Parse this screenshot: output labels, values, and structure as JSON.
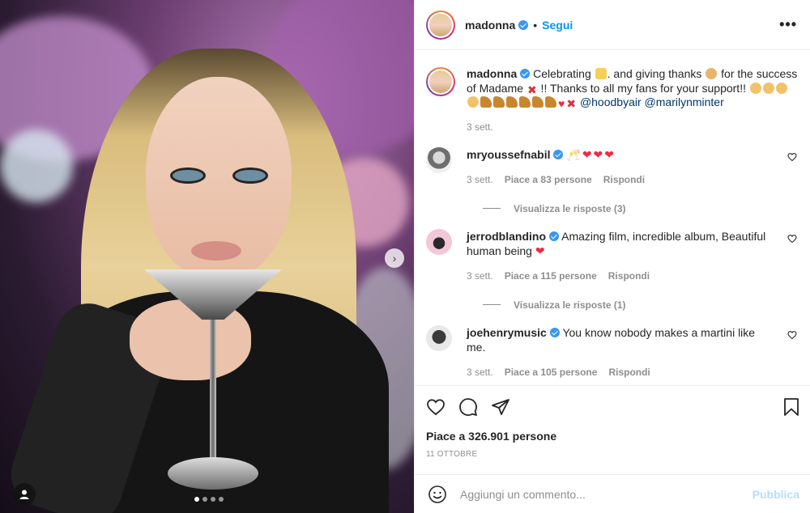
{
  "post": {
    "username": "madonna",
    "separator": "•",
    "follow_label": "Segui",
    "more_label": "•••",
    "carousel_dot_count": 4,
    "carousel_active_index": 0
  },
  "caption": {
    "username": "madonna",
    "text_parts": [
      {
        "kind": "text",
        "value": "Celebrating "
      },
      {
        "kind": "emoji",
        "name": "trophy-icon"
      },
      {
        "kind": "text",
        "value": ". and giving thanks "
      },
      {
        "kind": "emoji",
        "name": "pray-icon"
      },
      {
        "kind": "text",
        "value": " for the success of Madame "
      },
      {
        "kind": "emoji",
        "name": "x-icon"
      },
      {
        "kind": "text",
        "value": " !! Thanks to all my fans for your support!! "
      },
      {
        "kind": "emoji",
        "name": "clap-icon"
      },
      {
        "kind": "emoji",
        "name": "clap-icon"
      },
      {
        "kind": "emoji",
        "name": "clap-icon"
      },
      {
        "kind": "emoji",
        "name": "clap-icon"
      },
      {
        "kind": "emoji",
        "name": "shoe-icon"
      },
      {
        "kind": "emoji",
        "name": "shoe-icon"
      },
      {
        "kind": "emoji",
        "name": "shoe-icon"
      },
      {
        "kind": "emoji",
        "name": "shoe-icon"
      },
      {
        "kind": "emoji",
        "name": "shoe-icon"
      },
      {
        "kind": "emoji",
        "name": "shoe-icon"
      },
      {
        "kind": "emoji",
        "name": "heart-icon"
      },
      {
        "kind": "emoji",
        "name": "x-icon"
      },
      {
        "kind": "text",
        "value": " "
      },
      {
        "kind": "tag",
        "value": "@hoodbyair"
      },
      {
        "kind": "text",
        "value": " "
      },
      {
        "kind": "tag",
        "value": "@marilynminter"
      }
    ],
    "time": "3 sett."
  },
  "comments": [
    {
      "username": "mryoussefnabil",
      "avatar": "grey",
      "text": "",
      "emojis": [
        "🥂",
        "❤",
        "❤",
        "❤"
      ],
      "time": "3 sett.",
      "likes": "Piace a 83 persone",
      "reply_label": "Rispondi",
      "view_replies": "Visualizza le risposte (3)"
    },
    {
      "username": "jerrodblandino",
      "avatar": "pink",
      "text": "Amazing film, incredible album, Beautiful human being ",
      "emojis": [
        "❤"
      ],
      "time": "3 sett.",
      "likes": "Piace a 115 persone",
      "reply_label": "Rispondi",
      "view_replies": "Visualizza le risposte (1)"
    },
    {
      "username": "joehenrymusic",
      "avatar": "dark",
      "text": "You know nobody makes a martini like me.",
      "emojis": [],
      "time": "3 sett.",
      "likes": "Piace a 105 persone",
      "reply_label": "Rispondi",
      "view_replies": ""
    }
  ],
  "actions": {
    "likes_text": "Piace a 326.901 persone",
    "date": "11 OTTOBRE"
  },
  "add_comment": {
    "placeholder": "Aggiungi un commento...",
    "publish_label": "Pubblica"
  },
  "colors": {
    "accent": "#0095f6",
    "verified": "#3897f0",
    "publish_disabled": "#b2dffc",
    "muted": "#8e8e8e",
    "tag": "#00376b"
  }
}
